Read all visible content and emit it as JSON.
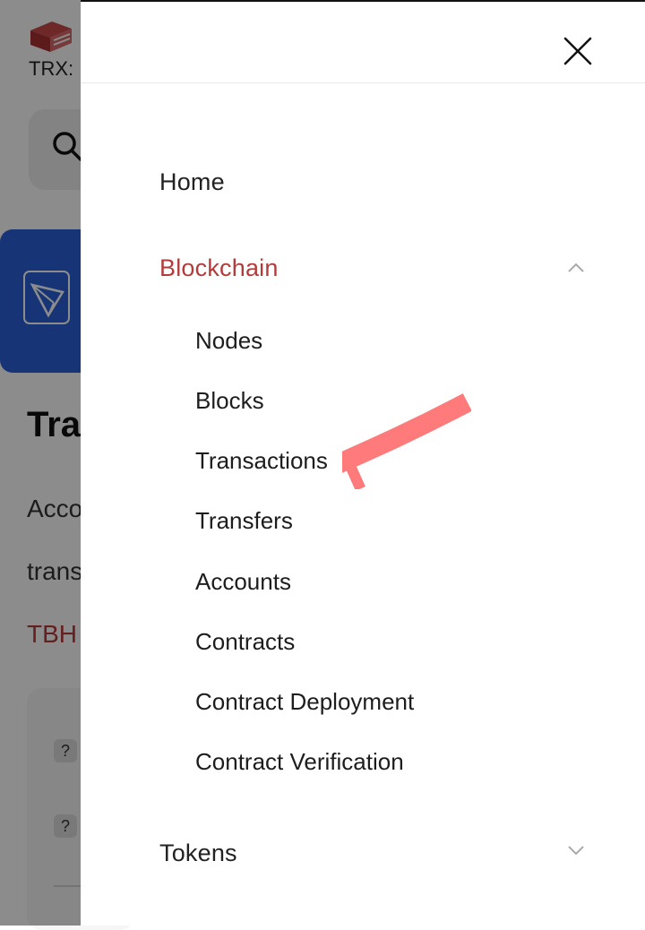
{
  "background": {
    "ticker": "TRX:",
    "title_fragment": "Tra",
    "text_fragment_1": "Acco",
    "text_fragment_2": "trans",
    "link_fragment": "TBH",
    "help_badge": "?"
  },
  "drawer": {
    "menu": {
      "home": "Home",
      "blockchain": "Blockchain",
      "tokens": "Tokens"
    },
    "blockchain_items": [
      "Nodes",
      "Blocks",
      "Transactions",
      "Transfers",
      "Accounts",
      "Contracts",
      "Contract Deployment",
      "Contract Verification"
    ]
  },
  "colors": {
    "accent": "#b43b3b",
    "banner": "#2a5fd9",
    "annotation": "#ff7a7a"
  },
  "icons": {
    "close": "close-icon",
    "expanded": "chevron-up-icon",
    "collapsed": "chevron-down-icon"
  }
}
